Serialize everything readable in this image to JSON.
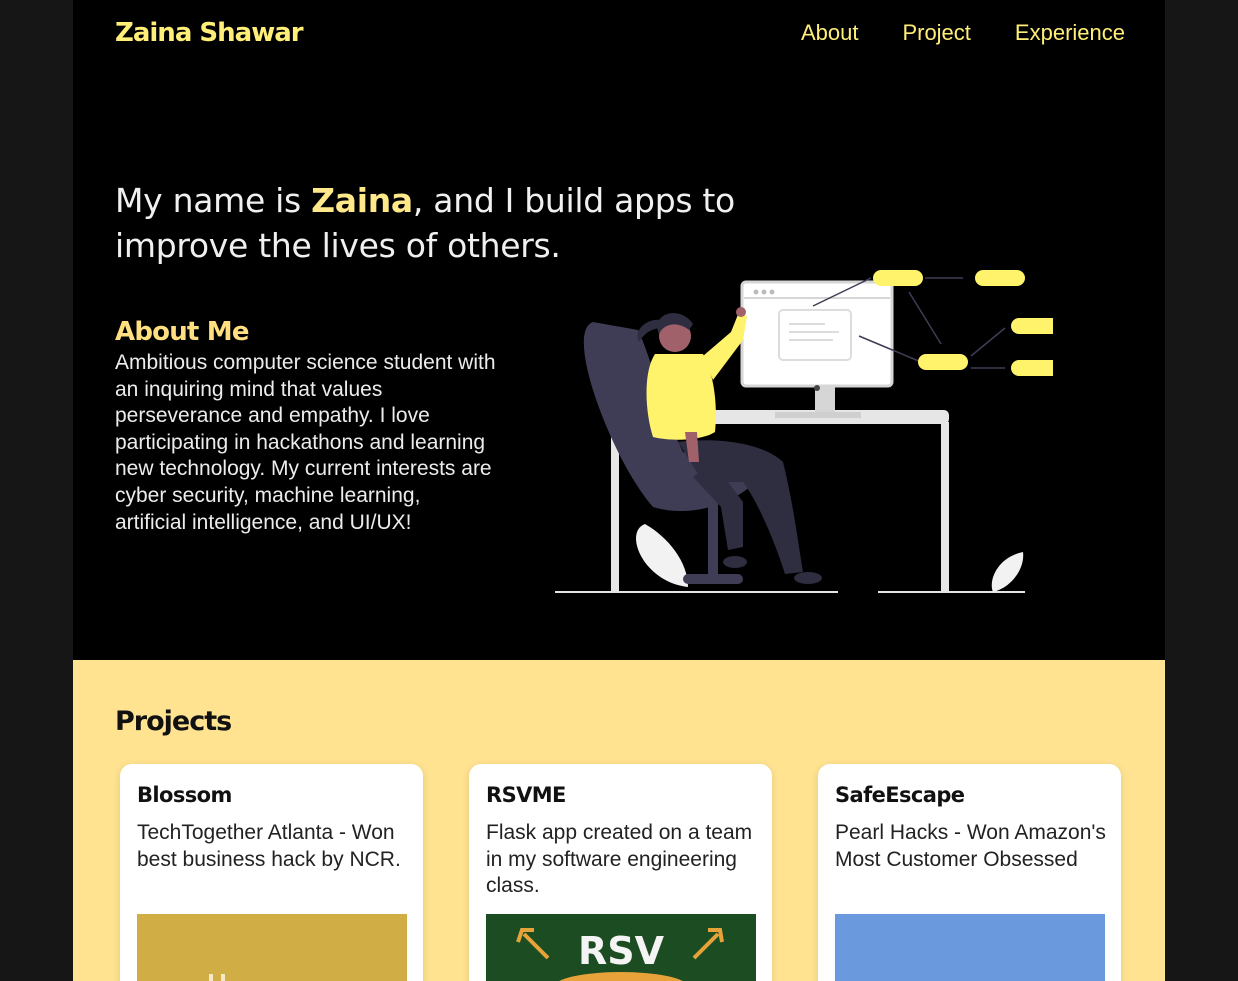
{
  "header": {
    "brand": "Zaina Shawar",
    "nav": [
      {
        "label": "About"
      },
      {
        "label": "Project"
      },
      {
        "label": "Experience"
      }
    ]
  },
  "hero": {
    "heading_prefix": "My name is ",
    "heading_name": "Zaina",
    "heading_suffix": ", and I build apps to improve the lives of others.",
    "about_title": "About Me",
    "about_text": "Ambitious computer science student with an inquiring mind that values perseverance and empathy. I love participating in hackathons and learning new technology. My current interests are cyber security, machine learning, artificial intelligence, and UI/UX!"
  },
  "projects": {
    "title": "Projects",
    "items": [
      {
        "name": "Blossom",
        "description": "TechTogether Atlanta - Won best business hack by NCR.",
        "thumb_color": "#d0ad45"
      },
      {
        "name": "RSVME",
        "description": "Flask app created on a team in my software engineering class.",
        "thumb_color": "#1c4d22",
        "thumb_text": "RSV"
      },
      {
        "name": "SafeEscape",
        "description": "Pearl Hacks - Won Amazon's Most Customer Obsessed",
        "thumb_color": "#6a9add"
      }
    ]
  },
  "colors": {
    "accent": "#ffee77",
    "hero_background": "#000000",
    "projects_background": "#ffe391"
  }
}
